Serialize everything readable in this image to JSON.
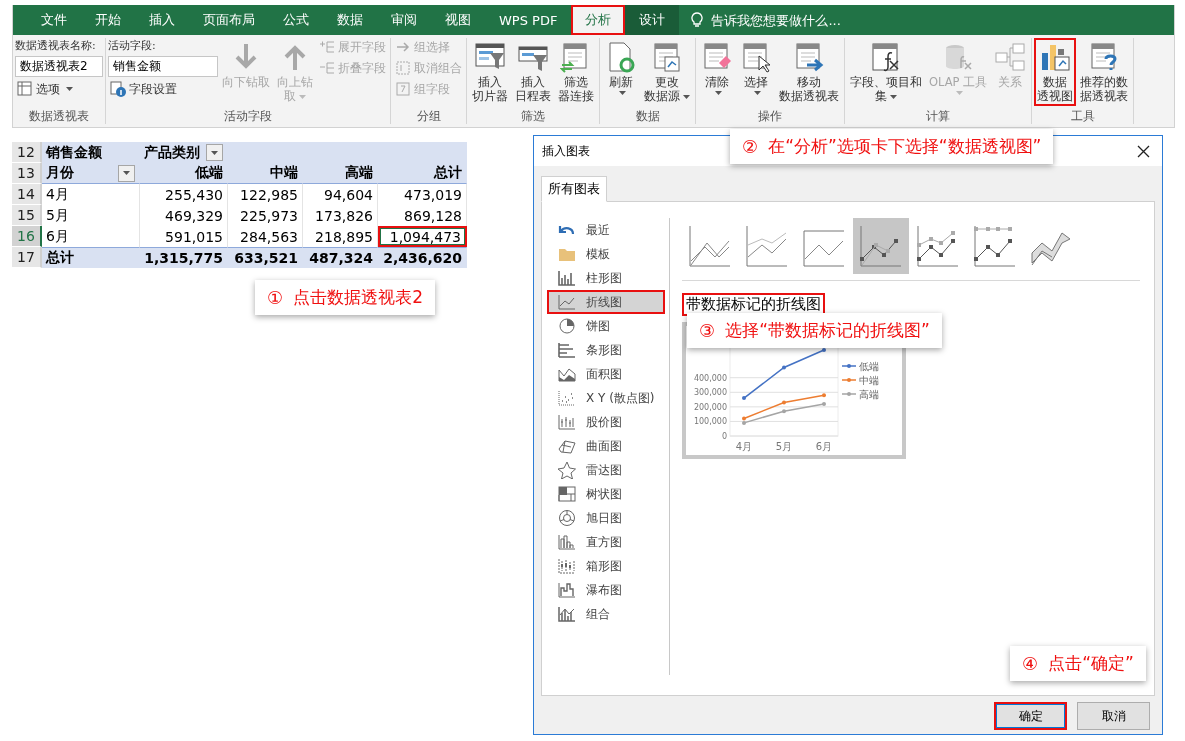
{
  "ribbon": {
    "tabs": [
      {
        "label": "文件",
        "kind": "normal",
        "selected": false,
        "highlighted": false
      },
      {
        "label": "开始",
        "kind": "normal",
        "selected": false,
        "highlighted": false
      },
      {
        "label": "插入",
        "kind": "normal",
        "selected": false,
        "highlighted": false
      },
      {
        "label": "页面布局",
        "kind": "normal",
        "selected": false,
        "highlighted": false
      },
      {
        "label": "公式",
        "kind": "normal",
        "selected": false,
        "highlighted": false
      },
      {
        "label": "数据",
        "kind": "normal",
        "selected": false,
        "highlighted": false
      },
      {
        "label": "审阅",
        "kind": "normal",
        "selected": false,
        "highlighted": false
      },
      {
        "label": "视图",
        "kind": "normal",
        "selected": false,
        "highlighted": false
      },
      {
        "label": "WPS PDF",
        "kind": "normal",
        "selected": false,
        "highlighted": false
      },
      {
        "label": "分析",
        "kind": "normal",
        "selected": true,
        "highlighted": true
      },
      {
        "label": "设计",
        "kind": "contextual",
        "selected": false,
        "highlighted": false
      }
    ],
    "tell_me": {
      "placeholder": "告诉我您想要做什么..."
    },
    "groups": [
      {
        "label": "数据透视表",
        "columns": [
          [
            {
              "kind": "caption",
              "label": "数据透视表名称:"
            },
            {
              "kind": "field",
              "value": "数据透视表2"
            },
            {
              "kind": "small",
              "label": "选项",
              "dropdown": true,
              "disabled": false
            }
          ]
        ]
      },
      {
        "label": "活动字段",
        "columns": [
          [
            {
              "kind": "caption",
              "label": "活动字段:"
            },
            {
              "kind": "field",
              "value": "销售金额"
            },
            {
              "kind": "small",
              "label": "字段设置",
              "dropdown": false,
              "disabled": false
            }
          ],
          [
            {
              "kind": "large",
              "lines": [
                "向下钻取"
              ],
              "dropdown": false,
              "disabled": true,
              "highlighted": false
            }
          ],
          [
            {
              "kind": "large",
              "lines": [
                "向上钻",
                "取"
              ],
              "dropdown": true,
              "disabled": true,
              "highlighted": false
            }
          ],
          [
            {
              "kind": "small",
              "label": "展开字段",
              "dropdown": false,
              "disabled": true
            },
            {
              "kind": "small",
              "label": "折叠字段",
              "dropdown": false,
              "disabled": true
            }
          ]
        ]
      },
      {
        "label": "分组",
        "columns": [
          [
            {
              "kind": "small",
              "label": "组选择",
              "dropdown": false,
              "disabled": true
            },
            {
              "kind": "small",
              "label": "取消组合",
              "dropdown": false,
              "disabled": true
            },
            {
              "kind": "small",
              "label": "组字段",
              "dropdown": false,
              "disabled": true
            }
          ]
        ]
      },
      {
        "label": "筛选",
        "columns": [
          [
            {
              "kind": "large",
              "lines": [
                "插入",
                "切片器"
              ],
              "dropdown": false,
              "disabled": false,
              "highlighted": false
            }
          ],
          [
            {
              "kind": "large",
              "lines": [
                "插入",
                "日程表"
              ],
              "dropdown": false,
              "disabled": false,
              "highlighted": false
            }
          ],
          [
            {
              "kind": "large",
              "lines": [
                "筛选",
                "器连接"
              ],
              "dropdown": false,
              "disabled": false,
              "highlighted": false
            }
          ]
        ]
      },
      {
        "label": "数据",
        "columns": [
          [
            {
              "kind": "large",
              "lines": [
                "刷新"
              ],
              "dropdown": true,
              "disabled": false,
              "highlighted": false
            }
          ],
          [
            {
              "kind": "large",
              "lines": [
                "更改",
                "数据源"
              ],
              "dropdown": true,
              "disabled": false,
              "highlighted": false
            }
          ]
        ]
      },
      {
        "label": "操作",
        "columns": [
          [
            {
              "kind": "large",
              "lines": [
                "清除"
              ],
              "dropdown": true,
              "disabled": false,
              "highlighted": false
            }
          ],
          [
            {
              "kind": "large",
              "lines": [
                "选择"
              ],
              "dropdown": true,
              "disabled": false,
              "highlighted": false
            }
          ],
          [
            {
              "kind": "large",
              "lines": [
                "移动",
                "数据透视表"
              ],
              "dropdown": false,
              "disabled": false,
              "highlighted": false
            }
          ]
        ]
      },
      {
        "label": "计算",
        "columns": [
          [
            {
              "kind": "large",
              "lines": [
                "字段、项目和",
                "集"
              ],
              "dropdown": true,
              "disabled": false,
              "highlighted": false
            }
          ],
          [
            {
              "kind": "large",
              "lines": [
                "OLAP 工具"
              ],
              "dropdown": true,
              "disabled": true,
              "highlighted": false
            }
          ],
          [
            {
              "kind": "large",
              "lines": [
                "关系"
              ],
              "dropdown": false,
              "disabled": true,
              "highlighted": false
            }
          ]
        ]
      },
      {
        "label": "工具",
        "columns": [
          [
            {
              "kind": "large",
              "lines": [
                "数据",
                "透视图"
              ],
              "dropdown": false,
              "disabled": false,
              "highlighted": true
            }
          ],
          [
            {
              "kind": "large",
              "lines": [
                "推荐的数",
                "据透视表"
              ],
              "dropdown": false,
              "disabled": false,
              "highlighted": false
            }
          ]
        ]
      }
    ]
  },
  "sheet": {
    "rows": [
      {
        "number": "12",
        "kind": "page",
        "selected": false,
        "cells": [
          {
            "text": "销售金额",
            "filter": false,
            "selected": false,
            "highlighted": false
          },
          {
            "text": "产品类别",
            "filter": true,
            "selected": false,
            "highlighted": false
          }
        ]
      },
      {
        "number": "13",
        "kind": "header",
        "selected": false,
        "cells": [
          {
            "text": "月份",
            "filter": true,
            "selected": false,
            "highlighted": false
          },
          {
            "text": "低端",
            "filter": false,
            "selected": false,
            "highlighted": false
          },
          {
            "text": "中端",
            "filter": false,
            "selected": false,
            "highlighted": false
          },
          {
            "text": "高端",
            "filter": false,
            "selected": false,
            "highlighted": false
          },
          {
            "text": "总计",
            "filter": false,
            "selected": false,
            "highlighted": false
          }
        ]
      },
      {
        "number": "14",
        "kind": "data",
        "selected": false,
        "cells": [
          {
            "text": "4月",
            "filter": false,
            "selected": false,
            "highlighted": false
          },
          {
            "text": "255,430",
            "filter": false,
            "selected": false,
            "highlighted": false
          },
          {
            "text": "122,985",
            "filter": false,
            "selected": false,
            "highlighted": false
          },
          {
            "text": "94,604",
            "filter": false,
            "selected": false,
            "highlighted": false
          },
          {
            "text": "473,019",
            "filter": false,
            "selected": false,
            "highlighted": false
          }
        ]
      },
      {
        "number": "15",
        "kind": "data",
        "selected": false,
        "cells": [
          {
            "text": "5月",
            "filter": false,
            "selected": false,
            "highlighted": false
          },
          {
            "text": "469,329",
            "filter": false,
            "selected": false,
            "highlighted": false
          },
          {
            "text": "225,973",
            "filter": false,
            "selected": false,
            "highlighted": false
          },
          {
            "text": "173,826",
            "filter": false,
            "selected": false,
            "highlighted": false
          },
          {
            "text": "869,128",
            "filter": false,
            "selected": false,
            "highlighted": false
          }
        ]
      },
      {
        "number": "16",
        "kind": "data",
        "selected": true,
        "cells": [
          {
            "text": "6月",
            "filter": false,
            "selected": false,
            "highlighted": false
          },
          {
            "text": "591,015",
            "filter": false,
            "selected": false,
            "highlighted": false
          },
          {
            "text": "284,563",
            "filter": false,
            "selected": false,
            "highlighted": false
          },
          {
            "text": "218,895",
            "filter": false,
            "selected": false,
            "highlighted": false
          },
          {
            "text": "1,094,473",
            "filter": false,
            "selected": true,
            "highlighted": true
          }
        ]
      },
      {
        "number": "17",
        "kind": "total",
        "selected": false,
        "cells": [
          {
            "text": "总计",
            "filter": false,
            "selected": false,
            "highlighted": false
          },
          {
            "text": "1,315,775",
            "filter": false,
            "selected": false,
            "highlighted": false
          },
          {
            "text": "633,521",
            "filter": false,
            "selected": false,
            "highlighted": false
          },
          {
            "text": "487,324",
            "filter": false,
            "selected": false,
            "highlighted": false
          },
          {
            "text": "2,436,620",
            "filter": false,
            "selected": false,
            "highlighted": false
          }
        ]
      }
    ]
  },
  "dialog": {
    "title": "插入图表",
    "tabs": [
      {
        "label": "所有图表",
        "selected": true
      }
    ],
    "chart_types": [
      {
        "label": "最近",
        "selected": false,
        "highlighted": false
      },
      {
        "label": "模板",
        "selected": false,
        "highlighted": false
      },
      {
        "label": "柱形图",
        "selected": false,
        "highlighted": false
      },
      {
        "label": "折线图",
        "selected": true,
        "highlighted": true
      },
      {
        "label": "饼图",
        "selected": false,
        "highlighted": false
      },
      {
        "label": "条形图",
        "selected": false,
        "highlighted": false
      },
      {
        "label": "面积图",
        "selected": false,
        "highlighted": false
      },
      {
        "label": "X Y (散点图)",
        "selected": false,
        "highlighted": false
      },
      {
        "label": "股价图",
        "selected": false,
        "highlighted": false
      },
      {
        "label": "曲面图",
        "selected": false,
        "highlighted": false
      },
      {
        "label": "雷达图",
        "selected": false,
        "highlighted": false
      },
      {
        "label": "树状图",
        "selected": false,
        "highlighted": false
      },
      {
        "label": "旭日图",
        "selected": false,
        "highlighted": false
      },
      {
        "label": "直方图",
        "selected": false,
        "highlighted": false
      },
      {
        "label": "箱形图",
        "selected": false,
        "highlighted": false
      },
      {
        "label": "瀑布图",
        "selected": false,
        "highlighted": false
      },
      {
        "label": "组合",
        "selected": false,
        "highlighted": false
      }
    ],
    "subtypes": [
      {
        "selected": false
      },
      {
        "selected": false
      },
      {
        "selected": false
      },
      {
        "selected": true
      },
      {
        "selected": false
      },
      {
        "selected": false
      },
      {
        "selected": false
      }
    ],
    "subtype_title": {
      "text": "带数据标记的折线图",
      "highlighted": true
    },
    "preview": {
      "chart_data": {
        "type": "line",
        "categories": [
          "4月",
          "5月",
          "6月"
        ],
        "series": [
          {
            "name": "低端",
            "color": "#4472c4",
            "values": [
              260000,
              470000,
              590000
            ]
          },
          {
            "name": "中端",
            "color": "#ed7d31",
            "values": [
              120000,
              230000,
              280000
            ]
          },
          {
            "name": "高端",
            "color": "#a5a5a5",
            "values": [
              90000,
              170000,
              220000
            ]
          }
        ],
        "ylim": [
          0,
          700000
        ],
        "yticks": [
          {
            "value": 0,
            "label": "0"
          },
          {
            "value": 100000,
            "label": "100,000"
          },
          {
            "value": 200000,
            "label": "200,000"
          },
          {
            "value": 300000,
            "label": "300,000"
          },
          {
            "value": 400000,
            "label": "400,000"
          }
        ],
        "grid": true,
        "legend": true
      }
    },
    "buttons": [
      {
        "label": "确定",
        "kind": "primary",
        "highlighted": true
      },
      {
        "label": "取消",
        "kind": "secondary",
        "highlighted": false
      }
    ]
  },
  "callouts": [
    {
      "step": "①",
      "text": "点击数据透视表2"
    },
    {
      "step": "②",
      "text": "在“分析”选项卡下选择“数据透视图”"
    },
    {
      "step": "③",
      "text": "选择“带数据标记的折线图”"
    },
    {
      "step": "④",
      "text": "点击“确定”"
    }
  ]
}
